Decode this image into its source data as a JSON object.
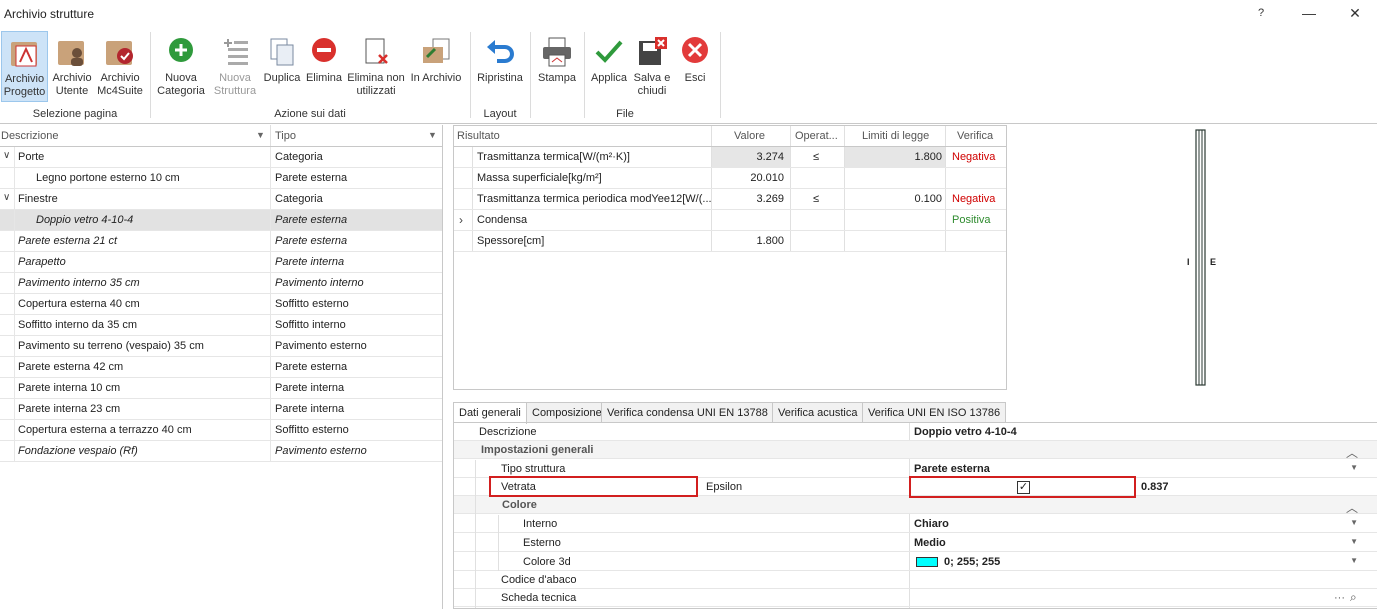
{
  "window": {
    "title": "Archivio strutture",
    "help": "?",
    "minimize": "—",
    "maximize": "☐",
    "close": "✕"
  },
  "ribbon": {
    "buttons": {
      "archivio_progetto": [
        "Archivio",
        "Progetto"
      ],
      "archivio_utente": [
        "Archivio",
        "Utente"
      ],
      "archivio_mc4": [
        "Archivio",
        "Mc4Suite"
      ],
      "nuova_categoria": [
        "Nuova",
        "Categoria"
      ],
      "nuova_struttura": [
        "Nuova",
        "Struttura"
      ],
      "duplica": "Duplica",
      "elimina": "Elimina",
      "elimina_non": [
        "Elimina non",
        "utilizzati"
      ],
      "in_archivio": "In Archivio",
      "ripristina": "Ripristina",
      "stampa": "Stampa",
      "applica": "Applica",
      "salva": [
        "Salva e",
        "chiudi"
      ],
      "esci": "Esci"
    },
    "groups": [
      "Selezione pagina",
      "Azione sui dati",
      "Layout",
      "File"
    ]
  },
  "tree": {
    "headers": [
      "Descrizione",
      "Tipo"
    ],
    "rows": [
      {
        "d": "Porte",
        "t": "Categoria",
        "level": 0,
        "exp": true
      },
      {
        "d": "Legno portone esterno 10 cm",
        "t": "Parete esterna",
        "level": 1
      },
      {
        "d": "Finestre",
        "t": "Categoria",
        "level": 0,
        "exp": true
      },
      {
        "d": "Doppio vetro 4-10-4",
        "t": "Parete esterna",
        "level": 1,
        "italic": true,
        "selected": true
      },
      {
        "d": "Parete esterna 21 ct",
        "t": "Parete esterna",
        "level": 0,
        "italic": true
      },
      {
        "d": "Parapetto",
        "t": "Parete interna",
        "level": 0,
        "italic": true
      },
      {
        "d": "Pavimento interno 35 cm",
        "t": "Pavimento interno",
        "level": 0,
        "italic": true
      },
      {
        "d": "Copertura esterna 40 cm",
        "t": "Soffitto esterno",
        "level": 0
      },
      {
        "d": "Soffitto interno da 35 cm",
        "t": "Soffitto interno",
        "level": 0
      },
      {
        "d": "Pavimento su terreno (vespaio) 35 cm",
        "t": "Pavimento esterno",
        "level": 0
      },
      {
        "d": "Parete esterna 42 cm",
        "t": "Parete esterna",
        "level": 0
      },
      {
        "d": "Parete interna 10 cm",
        "t": "Parete interna",
        "level": 0
      },
      {
        "d": "Parete interna 23 cm",
        "t": "Parete interna",
        "level": 0
      },
      {
        "d": "Copertura esterna a terrazzo 40 cm",
        "t": "Soffitto esterno",
        "level": 0
      },
      {
        "d": "Fondazione vespaio (Rf)",
        "t": "Pavimento esterno",
        "level": 0,
        "italic": true
      }
    ]
  },
  "results": {
    "headers": [
      "Risultato",
      "Valore",
      "Operat...",
      "Limiti di legge",
      "Verifica"
    ],
    "rows": [
      {
        "r": "Trasmittanza termica[W/(m²·K)]",
        "v": "3.274",
        "o": "≤",
        "l": "1.800",
        "ver": "Negativa",
        "st": "neg"
      },
      {
        "r": "Massa superficiale[kg/m²]",
        "v": "20.010",
        "o": "",
        "l": "",
        "ver": "",
        "st": ""
      },
      {
        "r": "Trasmittanza termica periodica modYee12[W/(...",
        "v": "3.269",
        "o": "≤",
        "l": "0.100",
        "ver": "Negativa",
        "st": "neg"
      },
      {
        "r": "Condensa",
        "v": "",
        "o": "",
        "l": "",
        "ver": "Positiva",
        "st": "pos",
        "expander": true
      },
      {
        "r": "Spessore[cm]",
        "v": "1.800",
        "o": "",
        "l": "",
        "ver": "",
        "st": ""
      }
    ]
  },
  "preview": {
    "label_i": "I",
    "label_e": "E"
  },
  "tabs": [
    "Dati generali",
    "Composizione",
    "Verifica condensa  UNI EN 13788",
    "Verifica acustica",
    "Verifica UNI EN ISO 13786"
  ],
  "props": {
    "descrizione_label": "Descrizione",
    "descrizione_value": "Doppio vetro 4-10-4",
    "impostazioni": "Impostazioni generali",
    "tipo_label": "Tipo struttura",
    "tipo_value": "Parete esterna",
    "vetrata_label": "Vetrata",
    "epsilon_label": "Epsilon",
    "epsilon_value": "0.837",
    "vetrata_checked": "✓",
    "colore": "Colore",
    "interno_label": "Interno",
    "interno_value": "Chiaro",
    "esterno_label": "Esterno",
    "esterno_value": "Medio",
    "colore3d_label": "Colore 3d",
    "colore3d_value": "0; 255; 255",
    "colore3d_hex": "#00ffff",
    "codice_label": "Codice d'abaco",
    "scheda_label": "Scheda tecnica",
    "scheda_btns": "···"
  }
}
